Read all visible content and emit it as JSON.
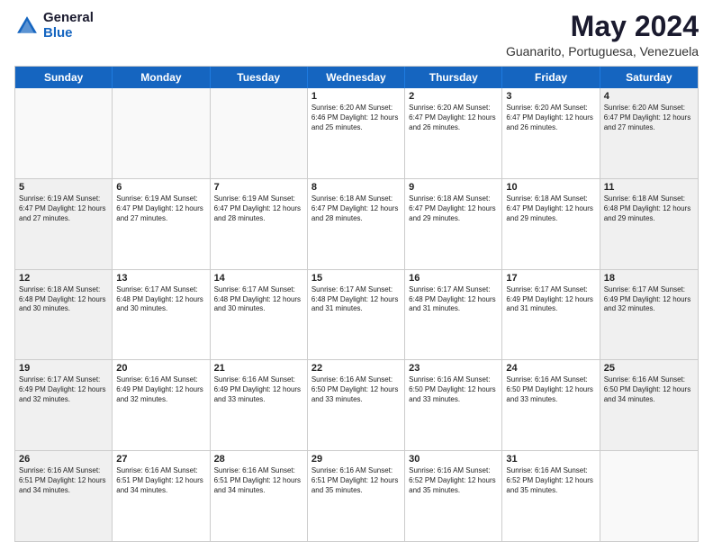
{
  "logo": {
    "general": "General",
    "blue": "Blue"
  },
  "title": "May 2024",
  "subtitle": "Guanarito, Portuguesa, Venezuela",
  "header_days": [
    "Sunday",
    "Monday",
    "Tuesday",
    "Wednesday",
    "Thursday",
    "Friday",
    "Saturday"
  ],
  "weeks": [
    [
      {
        "day": "",
        "info": "",
        "shaded": true
      },
      {
        "day": "",
        "info": "",
        "shaded": true
      },
      {
        "day": "",
        "info": "",
        "shaded": true
      },
      {
        "day": "1",
        "info": "Sunrise: 6:20 AM\nSunset: 6:46 PM\nDaylight: 12 hours and 25 minutes.",
        "shaded": false
      },
      {
        "day": "2",
        "info": "Sunrise: 6:20 AM\nSunset: 6:47 PM\nDaylight: 12 hours and 26 minutes.",
        "shaded": false
      },
      {
        "day": "3",
        "info": "Sunrise: 6:20 AM\nSunset: 6:47 PM\nDaylight: 12 hours and 26 minutes.",
        "shaded": false
      },
      {
        "day": "4",
        "info": "Sunrise: 6:20 AM\nSunset: 6:47 PM\nDaylight: 12 hours and 27 minutes.",
        "shaded": true
      }
    ],
    [
      {
        "day": "5",
        "info": "Sunrise: 6:19 AM\nSunset: 6:47 PM\nDaylight: 12 hours and 27 minutes.",
        "shaded": true
      },
      {
        "day": "6",
        "info": "Sunrise: 6:19 AM\nSunset: 6:47 PM\nDaylight: 12 hours and 27 minutes.",
        "shaded": false
      },
      {
        "day": "7",
        "info": "Sunrise: 6:19 AM\nSunset: 6:47 PM\nDaylight: 12 hours and 28 minutes.",
        "shaded": false
      },
      {
        "day": "8",
        "info": "Sunrise: 6:18 AM\nSunset: 6:47 PM\nDaylight: 12 hours and 28 minutes.",
        "shaded": false
      },
      {
        "day": "9",
        "info": "Sunrise: 6:18 AM\nSunset: 6:47 PM\nDaylight: 12 hours and 29 minutes.",
        "shaded": false
      },
      {
        "day": "10",
        "info": "Sunrise: 6:18 AM\nSunset: 6:47 PM\nDaylight: 12 hours and 29 minutes.",
        "shaded": false
      },
      {
        "day": "11",
        "info": "Sunrise: 6:18 AM\nSunset: 6:48 PM\nDaylight: 12 hours and 29 minutes.",
        "shaded": true
      }
    ],
    [
      {
        "day": "12",
        "info": "Sunrise: 6:18 AM\nSunset: 6:48 PM\nDaylight: 12 hours and 30 minutes.",
        "shaded": true
      },
      {
        "day": "13",
        "info": "Sunrise: 6:17 AM\nSunset: 6:48 PM\nDaylight: 12 hours and 30 minutes.",
        "shaded": false
      },
      {
        "day": "14",
        "info": "Sunrise: 6:17 AM\nSunset: 6:48 PM\nDaylight: 12 hours and 30 minutes.",
        "shaded": false
      },
      {
        "day": "15",
        "info": "Sunrise: 6:17 AM\nSunset: 6:48 PM\nDaylight: 12 hours and 31 minutes.",
        "shaded": false
      },
      {
        "day": "16",
        "info": "Sunrise: 6:17 AM\nSunset: 6:48 PM\nDaylight: 12 hours and 31 minutes.",
        "shaded": false
      },
      {
        "day": "17",
        "info": "Sunrise: 6:17 AM\nSunset: 6:49 PM\nDaylight: 12 hours and 31 minutes.",
        "shaded": false
      },
      {
        "day": "18",
        "info": "Sunrise: 6:17 AM\nSunset: 6:49 PM\nDaylight: 12 hours and 32 minutes.",
        "shaded": true
      }
    ],
    [
      {
        "day": "19",
        "info": "Sunrise: 6:17 AM\nSunset: 6:49 PM\nDaylight: 12 hours and 32 minutes.",
        "shaded": true
      },
      {
        "day": "20",
        "info": "Sunrise: 6:16 AM\nSunset: 6:49 PM\nDaylight: 12 hours and 32 minutes.",
        "shaded": false
      },
      {
        "day": "21",
        "info": "Sunrise: 6:16 AM\nSunset: 6:49 PM\nDaylight: 12 hours and 33 minutes.",
        "shaded": false
      },
      {
        "day": "22",
        "info": "Sunrise: 6:16 AM\nSunset: 6:50 PM\nDaylight: 12 hours and 33 minutes.",
        "shaded": false
      },
      {
        "day": "23",
        "info": "Sunrise: 6:16 AM\nSunset: 6:50 PM\nDaylight: 12 hours and 33 minutes.",
        "shaded": false
      },
      {
        "day": "24",
        "info": "Sunrise: 6:16 AM\nSunset: 6:50 PM\nDaylight: 12 hours and 33 minutes.",
        "shaded": false
      },
      {
        "day": "25",
        "info": "Sunrise: 6:16 AM\nSunset: 6:50 PM\nDaylight: 12 hours and 34 minutes.",
        "shaded": true
      }
    ],
    [
      {
        "day": "26",
        "info": "Sunrise: 6:16 AM\nSunset: 6:51 PM\nDaylight: 12 hours and 34 minutes.",
        "shaded": true
      },
      {
        "day": "27",
        "info": "Sunrise: 6:16 AM\nSunset: 6:51 PM\nDaylight: 12 hours and 34 minutes.",
        "shaded": false
      },
      {
        "day": "28",
        "info": "Sunrise: 6:16 AM\nSunset: 6:51 PM\nDaylight: 12 hours and 34 minutes.",
        "shaded": false
      },
      {
        "day": "29",
        "info": "Sunrise: 6:16 AM\nSunset: 6:51 PM\nDaylight: 12 hours and 35 minutes.",
        "shaded": false
      },
      {
        "day": "30",
        "info": "Sunrise: 6:16 AM\nSunset: 6:52 PM\nDaylight: 12 hours and 35 minutes.",
        "shaded": false
      },
      {
        "day": "31",
        "info": "Sunrise: 6:16 AM\nSunset: 6:52 PM\nDaylight: 12 hours and 35 minutes.",
        "shaded": false
      },
      {
        "day": "",
        "info": "",
        "shaded": true
      }
    ]
  ]
}
